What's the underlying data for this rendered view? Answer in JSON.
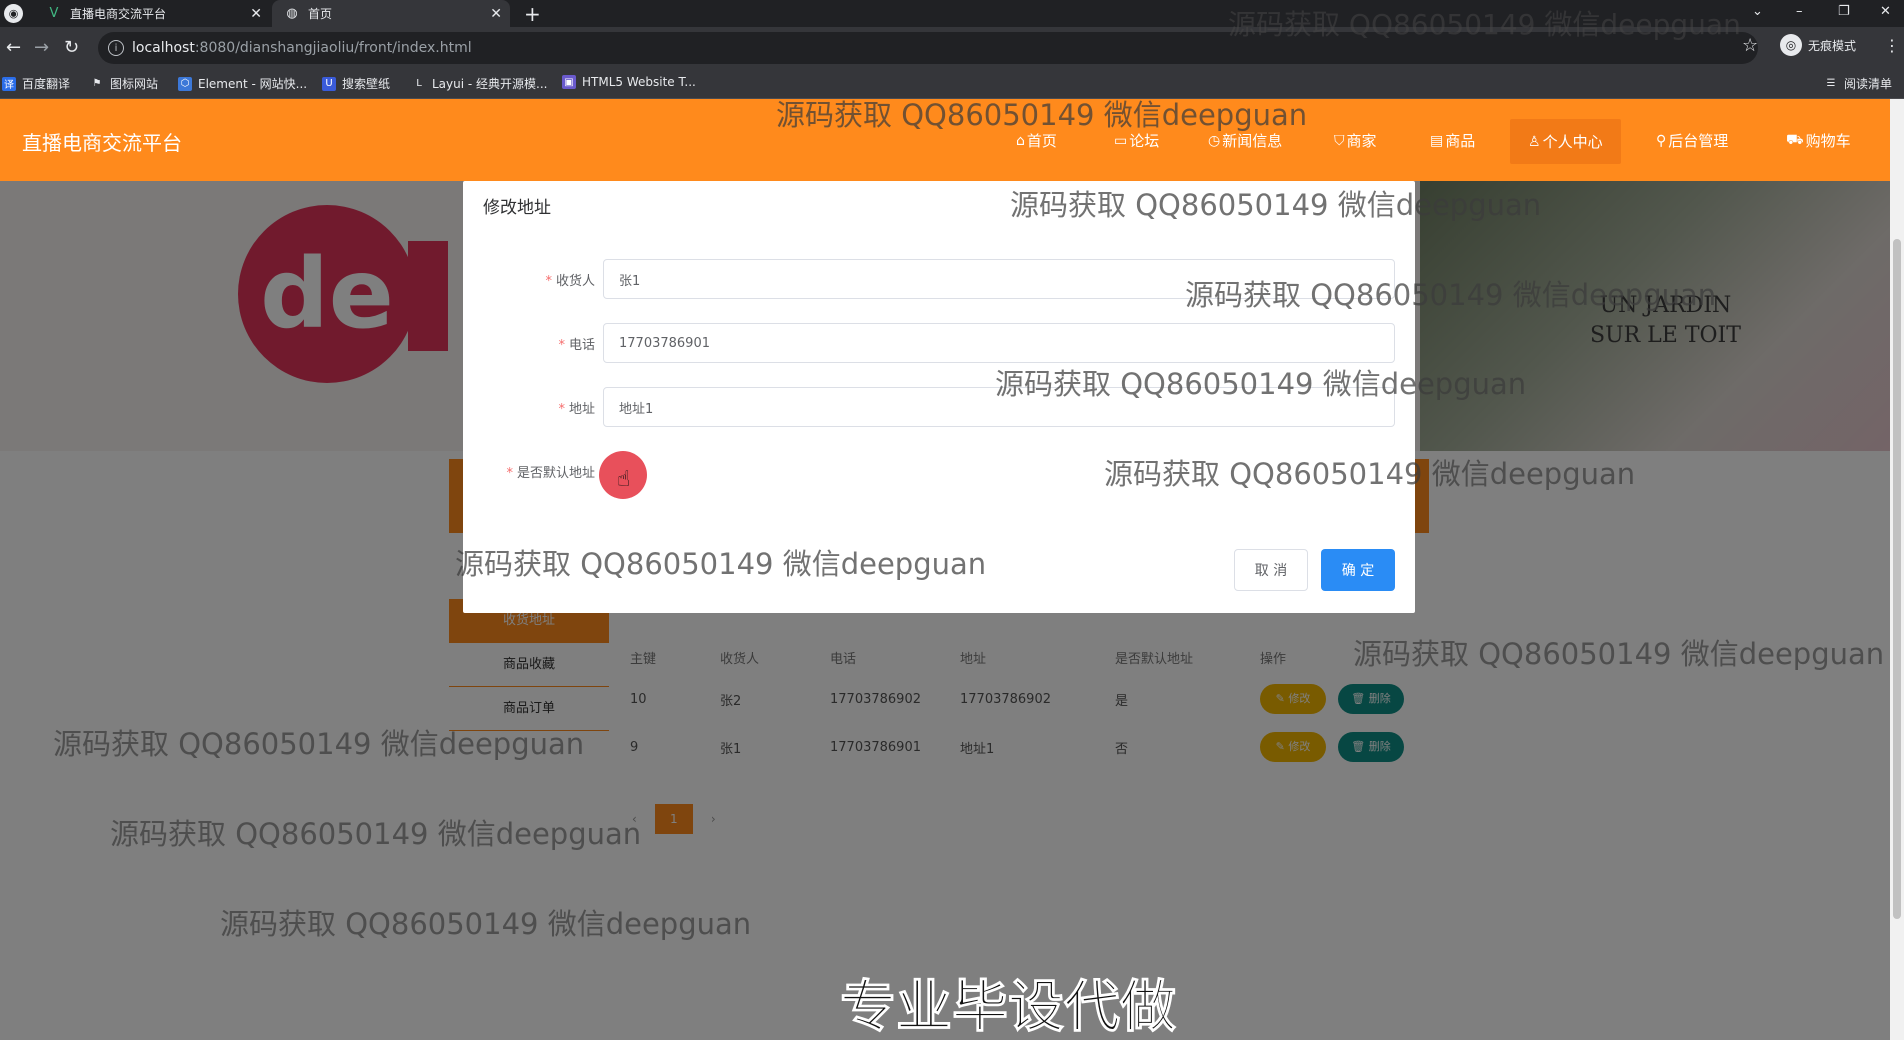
{
  "browser": {
    "tabs": [
      {
        "title": "直播电商交流平台",
        "icon": "vue-icon"
      },
      {
        "title": "首页",
        "icon": "globe-icon"
      }
    ],
    "url_host": "localhost",
    "url_path": ":8080/dianshangjiaoliu/front/index.html",
    "profile_label": "无痕模式",
    "bookmarks": [
      {
        "label": "百度翻译",
        "color": "#2b6de8"
      },
      {
        "label": "图标网站",
        "color": "#444444"
      },
      {
        "label": "Element - 网站快...",
        "color": "#3c78d8"
      },
      {
        "label": "搜索壁纸",
        "color": "#3a5bd9"
      },
      {
        "label": "Layui - 经典开源模...",
        "color": "#555555"
      },
      {
        "label": "HTML5 Website T...",
        "color": "#6a5acd"
      }
    ],
    "reading_list": "阅读清单"
  },
  "site": {
    "title": "直播电商交流平台",
    "nav": [
      "首页",
      "论坛",
      "新闻信息",
      "商家",
      "商品",
      "个人中心",
      "后台管理",
      "购物车"
    ],
    "active_nav": "个人中心",
    "accent": "#ff8a1c"
  },
  "banner": {
    "logo_text": "de",
    "bottle_line1": "UN JARDIN",
    "bottle_line2": "SUR LE TOIT"
  },
  "side_menu": [
    "收货地址",
    "商品收藏",
    "商品订单"
  ],
  "table": {
    "headers": [
      "主键",
      "收货人",
      "电话",
      "地址",
      "是否默认地址",
      "操作"
    ],
    "rows": [
      {
        "id": "10",
        "name": "张2",
        "phone": "17703786902",
        "address": "17703786902",
        "default": "是"
      },
      {
        "id": "9",
        "name": "张1",
        "phone": "17703786901",
        "address": "地址1",
        "default": "否"
      }
    ],
    "edit_label": "修改",
    "delete_label": "删除"
  },
  "pager": {
    "current": "1"
  },
  "dialog": {
    "title": "修改地址",
    "fields": [
      {
        "label": "收货人",
        "value": "张1"
      },
      {
        "label": "电话",
        "value": "17703786901"
      },
      {
        "label": "地址",
        "value": "地址1"
      }
    ],
    "switch_label": "是否默认地址",
    "cancel": "取 消",
    "confirm": "确 定"
  },
  "watermark": "源码获取 QQ86050149 微信deepguan",
  "caption": "专业毕设代做"
}
